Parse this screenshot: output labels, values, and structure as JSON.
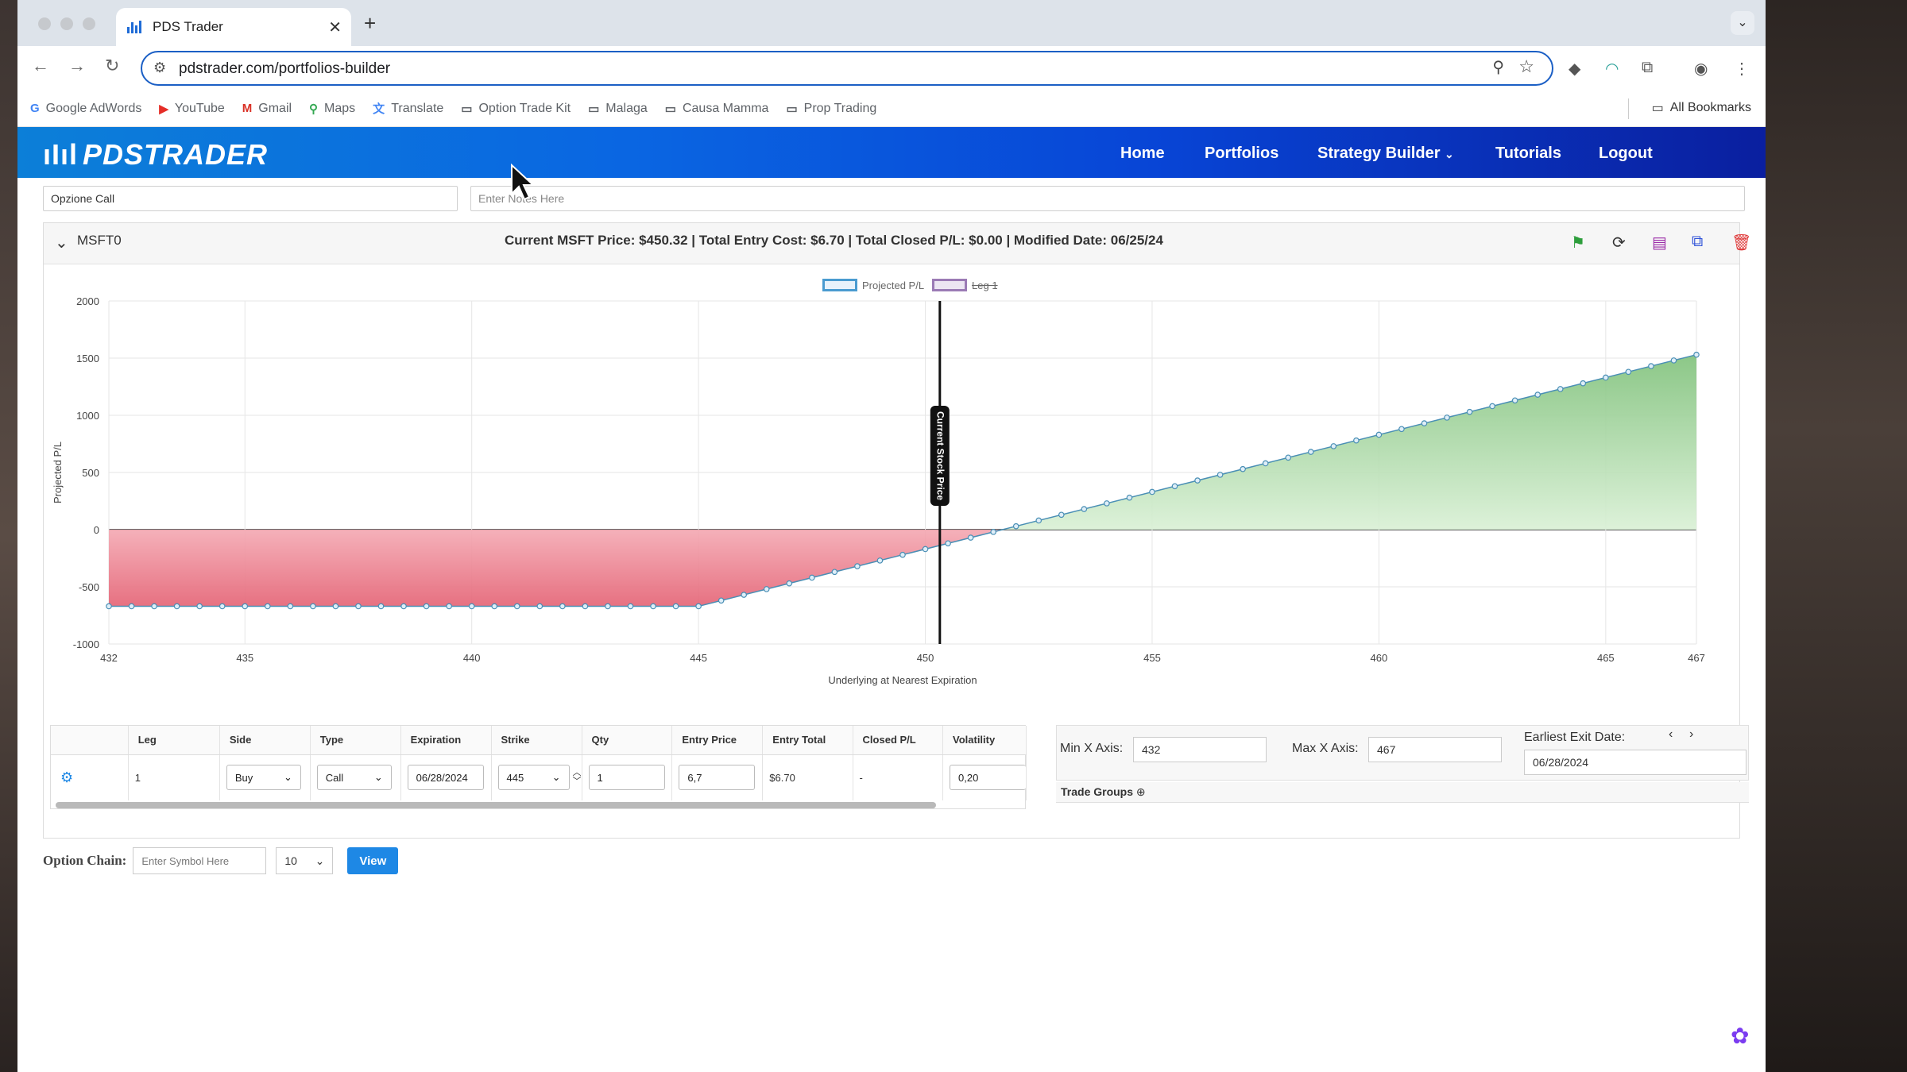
{
  "browser": {
    "tab_title": "PDS Trader",
    "url": "pdstrader.com/portfolios-builder",
    "bookmarks": [
      "Google AdWords",
      "YouTube",
      "Gmail",
      "Maps",
      "Translate",
      "Option Trade Kit",
      "Malaga",
      "Causa Mamma",
      "Prop Trading"
    ],
    "all_bookmarks": "All Bookmarks"
  },
  "site": {
    "logo": "PDSTRADER",
    "nav": {
      "home": "Home",
      "portfolios": "Portfolios",
      "strategy": "Strategy Builder",
      "tutorials": "Tutorials",
      "logout": "Logout"
    }
  },
  "portfolio": {
    "name_value": "Opzione Call",
    "notes_placeholder": "Enter Notes Here",
    "title": "MSFT0",
    "summary": "Current MSFT Price: $450.32 | Total Entry Cost: $6.70 | Total Closed P/L: $0.00 | Modified Date: 06/25/24"
  },
  "chart_data": {
    "type": "area",
    "legend": [
      "Projected P/L",
      "Leg 1"
    ],
    "xlabel": "Underlying at Nearest Expiration",
    "ylabel": "Projected P/L",
    "xlim": [
      432,
      467
    ],
    "ylim": [
      -1000,
      2000
    ],
    "x_ticks": [
      432,
      435,
      440,
      445,
      450,
      455,
      460,
      465,
      467
    ],
    "y_ticks": [
      2000,
      1500,
      1000,
      500,
      0,
      -500,
      -1000
    ],
    "vertical_line": {
      "x": 450.32,
      "label": "Current Stock Price"
    },
    "series": [
      {
        "name": "Projected P/L",
        "x": [
          432,
          445,
          451.7,
          467
        ],
        "y": [
          -670,
          -670,
          0,
          1530
        ]
      }
    ],
    "colors": {
      "loss": "#e8707e",
      "profit": "#a8dca0",
      "line": "#4a8fb5"
    }
  },
  "legs": {
    "headers": [
      "Leg",
      "Side",
      "Type",
      "Expiration",
      "Strike",
      "Qty",
      "Entry Price",
      "Entry Total",
      "Closed P/L",
      "Volatility"
    ],
    "row": {
      "leg": "1",
      "side": "Buy",
      "type": "Call",
      "expiration": "06/28/2024",
      "strike": "445",
      "qty": "1",
      "entry_price": "6,7",
      "entry_total": "$6.70",
      "closed_pl": "-",
      "volatility": "0,20"
    }
  },
  "axis": {
    "min_label": "Min X Axis:",
    "min_value": "432",
    "max_label": "Max X Axis:",
    "max_value": "467",
    "exit_label": "Earliest Exit Date:",
    "exit_value": "06/28/2024",
    "trade_groups": "Trade Groups"
  },
  "option_chain": {
    "label": "Option Chain:",
    "placeholder": "Enter Symbol Here",
    "count": "10",
    "button": "View"
  }
}
